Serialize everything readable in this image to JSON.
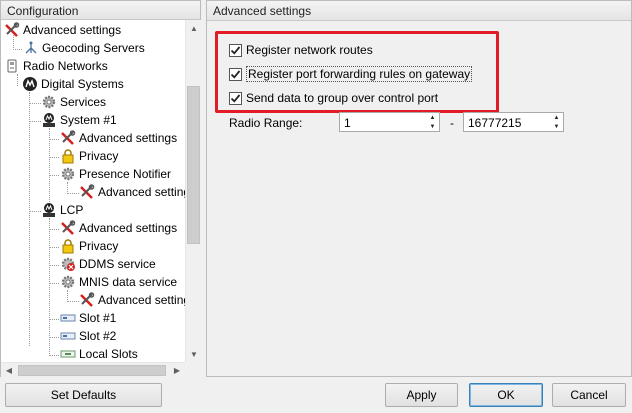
{
  "left_panel": {
    "title": "Configuration",
    "tree": [
      {
        "label": "Advanced settings",
        "icon": "tools-icon",
        "indent": 0
      },
      {
        "label": "Geocoding Servers",
        "icon": "antenna-icon",
        "indent": 1
      },
      {
        "label": "Radio Networks",
        "icon": "radio-network-icon",
        "indent": 0
      },
      {
        "label": "Digital Systems",
        "icon": "motorola-icon",
        "indent": 1
      },
      {
        "label": "Services",
        "icon": "gear-icon",
        "indent": 2
      },
      {
        "label": "System #1",
        "icon": "radio-system-icon",
        "indent": 2
      },
      {
        "label": "Advanced settings",
        "icon": "tools-icon",
        "indent": 3
      },
      {
        "label": "Privacy",
        "icon": "lock-icon",
        "indent": 3
      },
      {
        "label": "Presence Notifier",
        "icon": "gear-icon",
        "indent": 3
      },
      {
        "label": "Advanced setting",
        "icon": "tools-icon",
        "indent": 4
      },
      {
        "label": "LCP",
        "icon": "radio-system-icon",
        "indent": 2
      },
      {
        "label": "Advanced settings",
        "icon": "tools-icon",
        "indent": 3
      },
      {
        "label": "Privacy",
        "icon": "lock-icon",
        "indent": 3
      },
      {
        "label": "DDMS service",
        "icon": "ddms-gear-icon",
        "indent": 3
      },
      {
        "label": "MNIS data service",
        "icon": "gear-icon",
        "indent": 3
      },
      {
        "label": "Advanced setting",
        "icon": "tools-icon",
        "indent": 4
      },
      {
        "label": "Slot #1",
        "icon": "slot-icon",
        "indent": 3
      },
      {
        "label": "Slot #2",
        "icon": "slot-icon",
        "indent": 3
      },
      {
        "label": "Local Slots",
        "icon": "local-slots-icon",
        "indent": 3
      }
    ]
  },
  "right_panel": {
    "title": "Advanced settings",
    "checkboxes": [
      {
        "label": "Register network routes",
        "checked": true
      },
      {
        "label": "Register port forwarding rules on gateway",
        "checked": true
      },
      {
        "label": "Send data to group over control port",
        "checked": true
      }
    ],
    "radio_range": {
      "label": "Radio Range:",
      "from": "1",
      "separator": "-",
      "to": "16777215"
    }
  },
  "buttons": {
    "set_defaults": "Set Defaults",
    "apply": "Apply",
    "ok": "OK",
    "cancel": "Cancel"
  },
  "colors": {
    "highlight": "#e11c24",
    "tools_red": "#d42020",
    "lock_yellow": "#f2c811"
  }
}
